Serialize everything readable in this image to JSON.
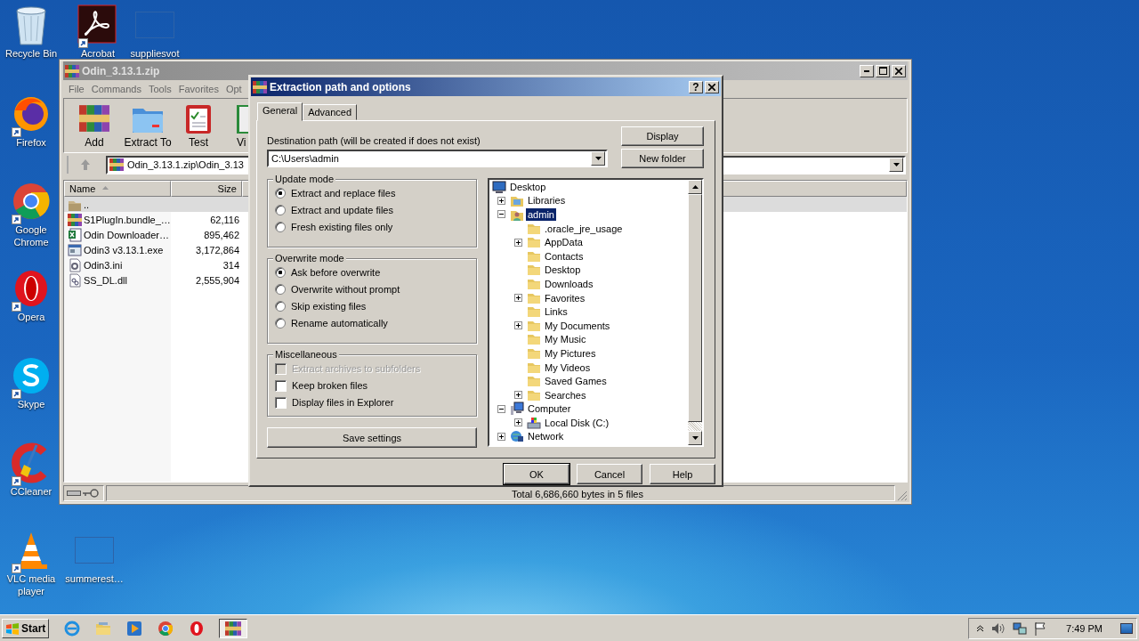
{
  "desktop_icons": [
    {
      "label": "Recycle Bin",
      "kind": "recycle"
    },
    {
      "label": "Acrobat",
      "kind": "acrobat"
    },
    {
      "label": "suppliesvot",
      "kind": "blank"
    },
    {
      "label": "Firefox",
      "kind": "firefox"
    },
    {
      "label": "Google Chrome",
      "kind": "chrome"
    },
    {
      "label": "Opera",
      "kind": "opera"
    },
    {
      "label": "Skype",
      "kind": "skype"
    },
    {
      "label": "CCleaner",
      "kind": "ccleaner"
    },
    {
      "label": "VLC media player",
      "kind": "vlc"
    },
    {
      "label": "summerest…",
      "kind": "blank"
    }
  ],
  "archive_window": {
    "title": "Odin_3.13.1.zip",
    "menu": [
      "File",
      "Commands",
      "Tools",
      "Favorites",
      "Opt"
    ],
    "toolbar": [
      {
        "label": "Add",
        "kind": "rar"
      },
      {
        "label": "Extract To",
        "kind": "folder"
      },
      {
        "label": "Test",
        "kind": "clipboard"
      },
      {
        "label": "Vi",
        "kind": "book"
      }
    ],
    "address": "Odin_3.13.1.zip\\Odin_3.13",
    "columns": [
      "Name",
      "Size"
    ],
    "files": [
      {
        "name": "..",
        "kind": "updir",
        "selected": true
      },
      {
        "name": "S1PlugIn.bundle_…",
        "size": "62,116",
        "kind": "rar",
        "selected": false
      },
      {
        "name": "Odin Downloader…",
        "size": "895,462",
        "kind": "excel",
        "selected": false
      },
      {
        "name": "Odin3 v3.13.1.exe",
        "size": "3,172,864",
        "kind": "exe",
        "selected": false
      },
      {
        "name": "Odin3.ini",
        "size": "314",
        "kind": "ini",
        "selected": false
      },
      {
        "name": "SS_DL.dll",
        "size": "2,555,904",
        "kind": "dll",
        "selected": false
      }
    ],
    "status": "Total 6,686,660 bytes in 5 files"
  },
  "dialog": {
    "title": "Extraction path and options",
    "help": "?",
    "tabs": [
      {
        "label": "General",
        "selected": true
      },
      {
        "label": "Advanced",
        "selected": false
      }
    ],
    "destination_label": "Destination path (will be created if does not exist)",
    "destination": "C:\\Users\\admin",
    "side_buttons": [
      "Display",
      "New folder"
    ],
    "groups": [
      {
        "title": "Update mode",
        "kind": "radio",
        "options": [
          {
            "label": "Extract and replace files",
            "selected": true
          },
          {
            "label": "Extract and update files",
            "selected": false
          },
          {
            "label": "Fresh existing files only",
            "selected": false
          }
        ]
      },
      {
        "title": "Overwrite mode",
        "kind": "radio",
        "options": [
          {
            "label": "Ask before overwrite",
            "selected": true
          },
          {
            "label": "Overwrite without prompt",
            "selected": false
          },
          {
            "label": "Skip existing files",
            "selected": false
          },
          {
            "label": "Rename automatically",
            "selected": false
          }
        ]
      },
      {
        "title": "Miscellaneous",
        "kind": "checkbox",
        "options": [
          {
            "label": "Extract archives to subfolders",
            "checked": false,
            "disabled": true
          },
          {
            "label": "Keep broken files",
            "checked": false,
            "disabled": false
          },
          {
            "label": "Display files in Explorer",
            "checked": false,
            "disabled": false
          }
        ]
      }
    ],
    "save_button": "Save settings",
    "tree": [
      {
        "label": "Desktop",
        "kind": "desktop",
        "selected": false,
        "children": [
          {
            "label": "Libraries",
            "kind": "library",
            "expanded": false,
            "selected": false
          },
          {
            "label": "admin",
            "kind": "user",
            "expanded": true,
            "selected": true,
            "children": [
              {
                "label": ".oracle_jre_usage",
                "kind": "folder",
                "selected": false
              },
              {
                "label": "AppData",
                "kind": "folder",
                "expanded": false,
                "selected": false
              },
              {
                "label": "Contacts",
                "kind": "folder",
                "selected": false
              },
              {
                "label": "Desktop",
                "kind": "folder",
                "selected": false
              },
              {
                "label": "Downloads",
                "kind": "folder",
                "selected": false
              },
              {
                "label": "Favorites",
                "kind": "folder",
                "expanded": false,
                "selected": false
              },
              {
                "label": "Links",
                "kind": "folder",
                "selected": false
              },
              {
                "label": "My Documents",
                "kind": "folder",
                "expanded": false,
                "selected": false
              },
              {
                "label": "My Music",
                "kind": "folder",
                "selected": false
              },
              {
                "label": "My Pictures",
                "kind": "folder",
                "selected": false
              },
              {
                "label": "My Videos",
                "kind": "folder",
                "selected": false
              },
              {
                "label": "Saved Games",
                "kind": "folder",
                "selected": false
              },
              {
                "label": "Searches",
                "kind": "folder",
                "expanded": false,
                "selected": false
              }
            ]
          },
          {
            "label": "Computer",
            "kind": "computer",
            "expanded": true,
            "selected": false,
            "children": [
              {
                "label": "Local Disk (C:)",
                "kind": "disk",
                "expanded": false,
                "selected": false
              }
            ]
          },
          {
            "label": "Network",
            "kind": "network",
            "expanded": false,
            "selected": false
          }
        ]
      }
    ],
    "buttons": [
      "OK",
      "Cancel",
      "Help"
    ]
  },
  "taskbar": {
    "start": "Start",
    "apps": [
      {
        "kind": "ie",
        "active": false
      },
      {
        "kind": "explorer",
        "active": false
      },
      {
        "kind": "media",
        "active": false
      },
      {
        "kind": "chrome",
        "active": false
      },
      {
        "kind": "opera",
        "active": false
      },
      {
        "kind": "rar",
        "active": true
      }
    ],
    "clock": "7:49 PM"
  }
}
